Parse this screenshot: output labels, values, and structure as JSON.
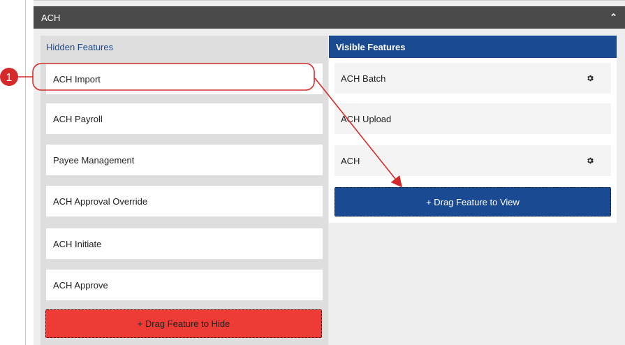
{
  "header": {
    "title": "ACH",
    "collapse_icon": "chevron-up-icon"
  },
  "hidden": {
    "title": "Hidden Features",
    "items": [
      {
        "label": "ACH Import"
      },
      {
        "label": "ACH Payroll"
      },
      {
        "label": "Payee Management"
      },
      {
        "label": "ACH Approval Override"
      },
      {
        "label": "ACH Initiate"
      },
      {
        "label": "ACH Approve"
      }
    ],
    "drop_label": "+ Drag Feature to Hide"
  },
  "visible": {
    "title": "Visible Features",
    "items": [
      {
        "label": "ACH Batch",
        "icon": "gear-icon"
      },
      {
        "label": "ACH Upload"
      },
      {
        "label": "ACH",
        "icon": "gear-icon"
      }
    ],
    "drop_label": "+ Drag Feature to View"
  },
  "annotation": {
    "step_number": "1"
  },
  "colors": {
    "header": "#4a4a4a",
    "visible_accent": "#1a4a91",
    "hide_accent": "#ee3b35",
    "annotation": "#d42a2a"
  }
}
